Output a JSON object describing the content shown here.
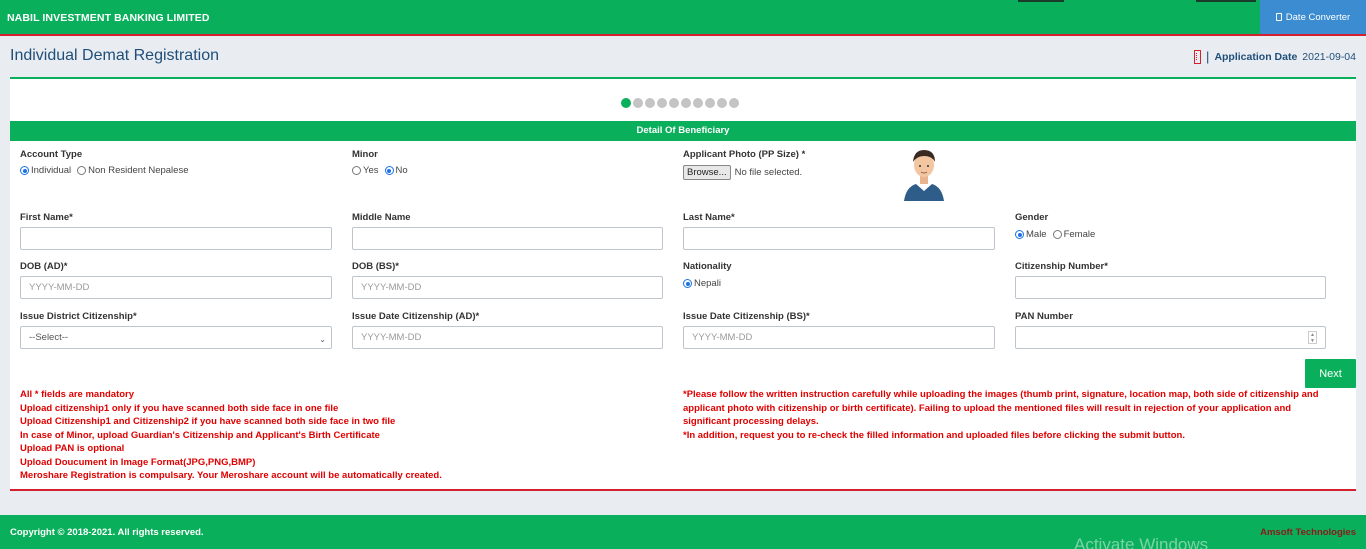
{
  "header": {
    "brand": "NABIL INVESTMENT BANKING LIMITED",
    "date_converter_label": "Date Converter"
  },
  "page": {
    "title": "Individual Demat Registration",
    "application_date_label": "Application Date",
    "application_date_value": "2021-09-04",
    "separator": "|"
  },
  "stepper": {
    "total_steps": 10,
    "active_step": 1
  },
  "section": {
    "title": "Detail Of Beneficiary"
  },
  "form": {
    "account_type": {
      "label": "Account Type",
      "options": [
        "Individual",
        "Non Resident Nepalese"
      ],
      "selected": "Individual"
    },
    "minor": {
      "label": "Minor",
      "options": [
        "Yes",
        "No"
      ],
      "selected": "No"
    },
    "photo": {
      "label": "Applicant Photo (PP Size) *",
      "browse_label": "Browse...",
      "file_status": "No file selected."
    },
    "first_name": {
      "label": "First Name*",
      "value": ""
    },
    "middle_name": {
      "label": "Middle Name",
      "value": ""
    },
    "last_name": {
      "label": "Last Name*",
      "value": ""
    },
    "gender": {
      "label": "Gender",
      "options": [
        "Male",
        "Female"
      ],
      "selected": "Male"
    },
    "dob_ad": {
      "label": "DOB (AD)*",
      "placeholder": "YYYY-MM-DD"
    },
    "dob_bs": {
      "label": "DOB (BS)*",
      "placeholder": "YYYY-MM-DD"
    },
    "nationality": {
      "label": "Nationality",
      "options": [
        "Nepali"
      ],
      "selected": "Nepali"
    },
    "citizenship_number": {
      "label": "Citizenship Number*",
      "value": ""
    },
    "issue_district": {
      "label": "Issue District Citizenship*",
      "selected": "--Select--"
    },
    "issue_date_ad": {
      "label": "Issue Date Citizenship (AD)*",
      "placeholder": "YYYY-MM-DD"
    },
    "issue_date_bs": {
      "label": "Issue Date Citizenship (BS)*",
      "placeholder": "YYYY-MM-DD"
    },
    "pan_number": {
      "label": "PAN Number",
      "value": ""
    },
    "next_label": "Next"
  },
  "notes_left": [
    "All * fields are mandatory",
    "Upload citizenship1 only if you have scanned both side face in one file",
    "Upload Citizenship1 and Citizenship2 if you have scanned both side face in two file",
    "In case of Minor, upload Guardian's Citizenship and Applicant's Birth Certificate",
    "Upload PAN is optional",
    "Upload Doucument in Image Format(JPG,PNG,BMP)",
    "Meroshare Registration is compulsary. Your Meroshare account will be automatically created."
  ],
  "notes_right": [
    "*Please follow the written instruction carefully while uploading the images (thumb print, signature, location map, both side of citizenship and applicant photo with citizenship or birth certificate). Failing to upload the mentioned files will result in rejection of your application and significant processing delays.",
    "*In addition, request you to re-check the filled information and uploaded files before clicking the submit button."
  ],
  "footer": {
    "copyright": "Copyright © 2018-2021. All rights reserved.",
    "company": "Amsoft Technologies",
    "watermark": "Activate Windows"
  },
  "colors": {
    "primary_green": "#0aaf5b",
    "accent_red": "#d3202f",
    "title_blue": "#1f4e79",
    "button_blue": "#3b8cd1",
    "note_red": "#e00000"
  }
}
